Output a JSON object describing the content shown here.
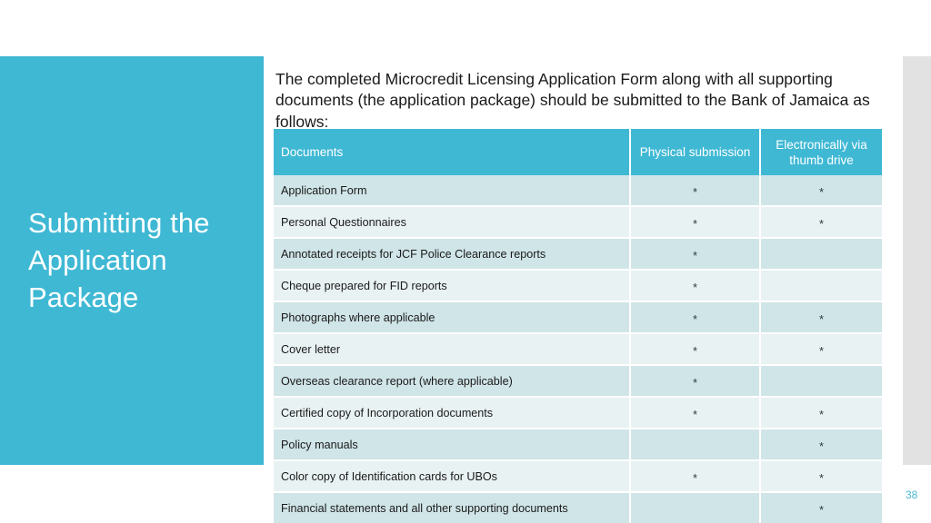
{
  "slide": {
    "title": "Submitting the\nApplication\nPackage",
    "page_number": "38",
    "accent_color": "#3fb8d4",
    "row_color_odd": "#d0e5e8",
    "row_color_even": "#e9f2f3",
    "strip_color": "#e2e2e2",
    "page_number_color": "#4cb6d4"
  },
  "intro": {
    "text": "The completed Microcredit Licensing Application Form along with all supporting documents (the application package) should be submitted to the Bank of Jamaica as follows:"
  },
  "table": {
    "columns": [
      {
        "label": "Documents",
        "align": "left"
      },
      {
        "label": "Physical submission",
        "align": "center"
      },
      {
        "label": "Electronically via thumb drive",
        "align": "center"
      }
    ],
    "mark_glyph": "*",
    "rows": [
      {
        "document": "Application Form",
        "physical": "*",
        "electronic": "*"
      },
      {
        "document": "Personal Questionnaires",
        "physical": "*",
        "electronic": "*"
      },
      {
        "document": "Annotated receipts for JCF Police Clearance reports",
        "physical": "*",
        "electronic": ""
      },
      {
        "document": "Cheque prepared for FID reports",
        "physical": "*",
        "electronic": ""
      },
      {
        "document": "Photographs where applicable",
        "physical": "*",
        "electronic": "*"
      },
      {
        "document": "Cover letter",
        "physical": "*",
        "electronic": "*"
      },
      {
        "document": "Overseas clearance report (where applicable)",
        "physical": "*",
        "electronic": ""
      },
      {
        "document": "Certified copy of Incorporation documents",
        "physical": "*",
        "electronic": "*"
      },
      {
        "document": "Policy manuals",
        "physical": "",
        "electronic": "*"
      },
      {
        "document": "Color copy of Identification cards for  UBOs",
        "physical": "*",
        "electronic": "*"
      },
      {
        "document": "Financial statements and all other supporting documents",
        "physical": "",
        "electronic": "*"
      }
    ]
  }
}
